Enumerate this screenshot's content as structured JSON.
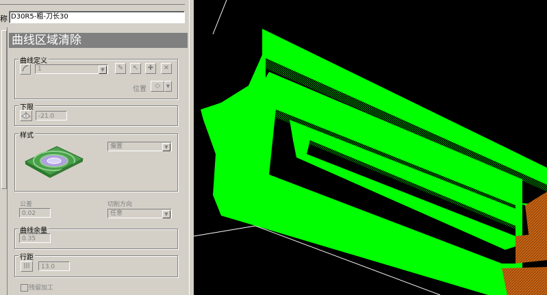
{
  "form": {
    "name_label": "称",
    "name_value": "D30R5-粗-刀长30",
    "title": "曲线区域清除"
  },
  "curve_def": {
    "label": "曲线定义",
    "value": "1",
    "position_label": "位置"
  },
  "lower_limit": {
    "label": "下限",
    "value": "-21.0"
  },
  "style": {
    "label": "样式",
    "value": "偏置"
  },
  "tolerance": {
    "label": "公差",
    "value": "0.02"
  },
  "cut_direction": {
    "label": "切削方向",
    "value": "任意"
  },
  "curve_allowance": {
    "label": "曲线余量",
    "value": "0.35"
  },
  "stepover": {
    "label": "行距",
    "value": "13.0"
  },
  "rest_machining": {
    "label": "残留加工",
    "checked": false
  },
  "icons": {
    "curve": "curve-select-icon",
    "lower": "lower-limit-icon",
    "style_preview": "offset-pattern-preview-icon",
    "stepover": "stepover-icon"
  },
  "colors": {
    "panel": "#d4d0c8",
    "title_bar": "#808080",
    "toolpath": "#00ff00",
    "stock": "#c86414",
    "background": "#000000"
  }
}
